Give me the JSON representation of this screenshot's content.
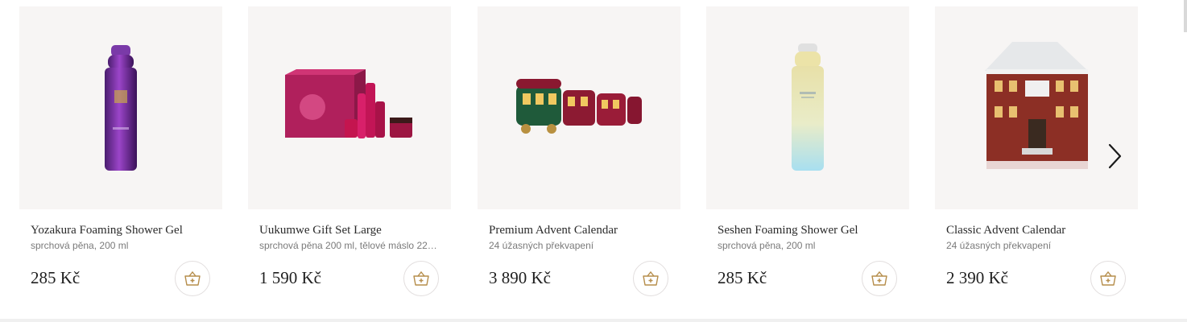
{
  "products": [
    {
      "name": "Yozakura Foaming Shower Gel",
      "desc": "sprchová pěna, 200 ml",
      "price": "285 Kč",
      "image_icon": "purple-spray-can-icon"
    },
    {
      "name": "Uukumwe Gift Set Large",
      "desc": "sprchová pěna 200 ml, tělové máslo 220 ...",
      "price": "1 590 Kč",
      "image_icon": "pink-gift-set-icon"
    },
    {
      "name": "Premium Advent Calendar",
      "desc": "24 úžasných překvapení",
      "price": "3 890 Kč",
      "image_icon": "train-advent-calendar-icon"
    },
    {
      "name": "Seshen Foaming Shower Gel",
      "desc": "sprchová pěna, 200 ml",
      "price": "285 Kč",
      "image_icon": "pastel-spray-can-icon"
    },
    {
      "name": "Classic Advent Calendar",
      "desc": "24 úžasných překvapení",
      "price": "2 390 Kč",
      "image_icon": "house-advent-calendar-icon"
    }
  ],
  "colors": {
    "card_bg": "#f7f5f4",
    "text": "#2a2a2a",
    "muted": "#7a7a7a"
  }
}
